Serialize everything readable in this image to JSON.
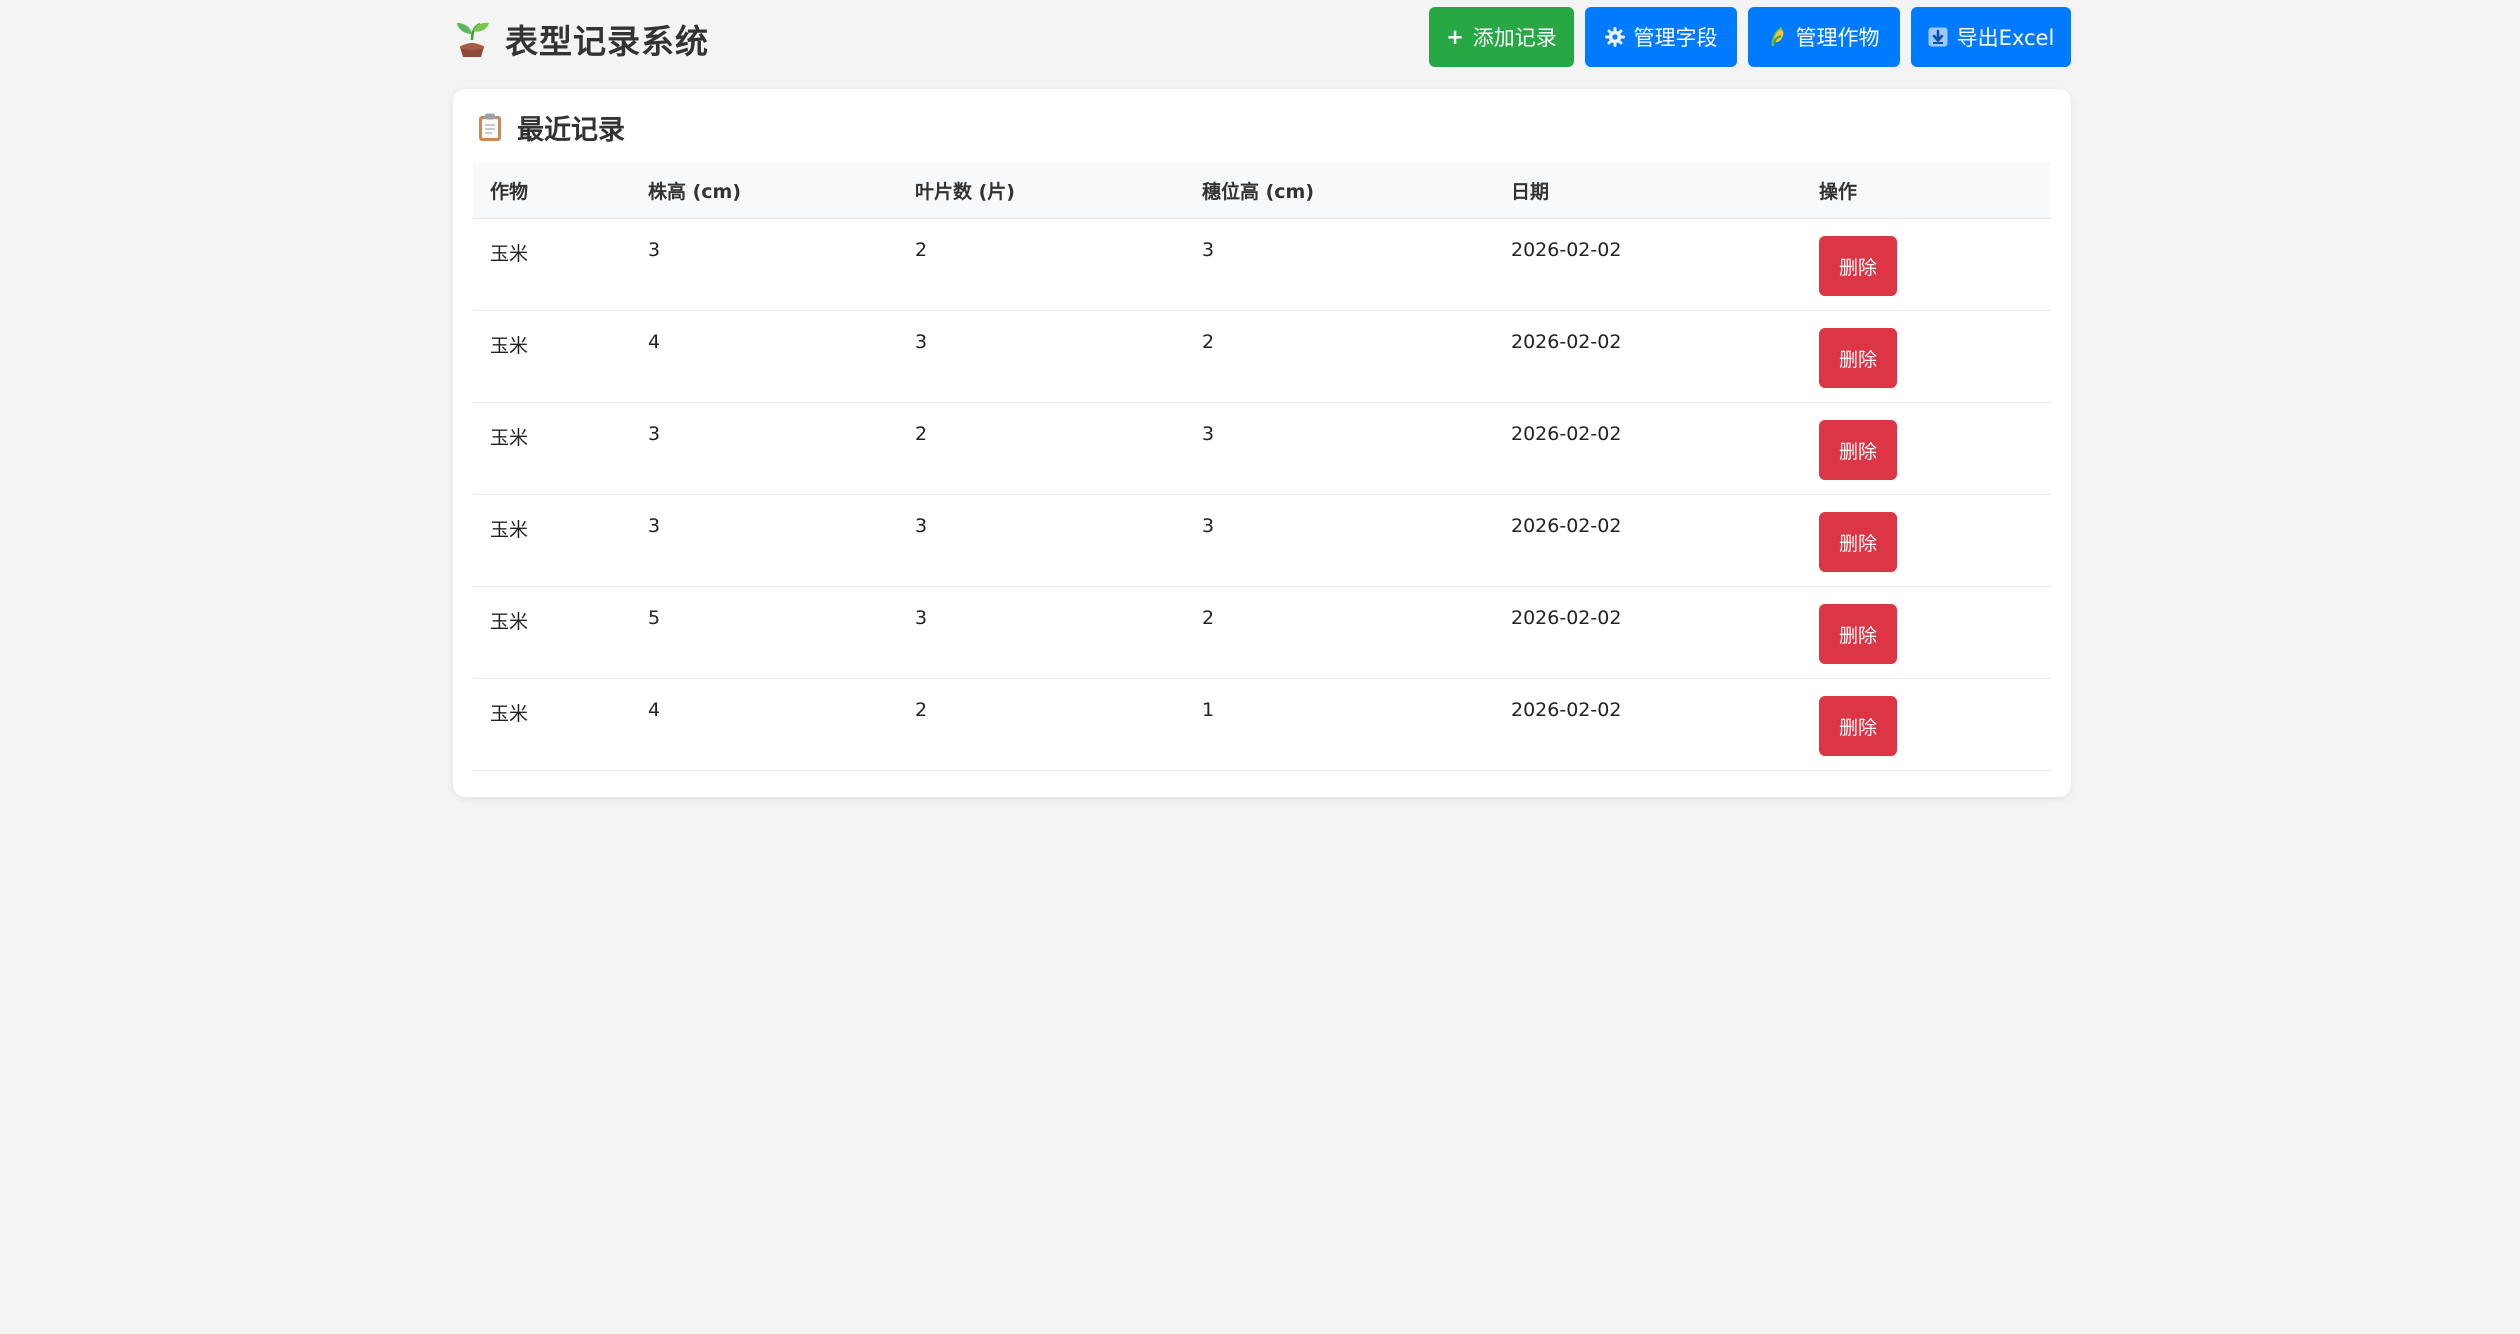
{
  "app": {
    "title": "表型记录系统",
    "logo_icon": "seedling-icon"
  },
  "toolbar": {
    "add_label": "添加记录",
    "add_icon": "plus-icon",
    "fields_label": "管理字段",
    "fields_icon": "gear-icon",
    "crops_label": "管理作物",
    "crops_icon": "corn-icon",
    "export_label": "导出Excel",
    "export_icon": "download-arrow-icon"
  },
  "records": {
    "title": "最近记录",
    "title_icon": "clipboard-icon",
    "columns": [
      "作物",
      "株高 (cm)",
      "叶片数 (片)",
      "穗位高 (cm)",
      "日期",
      "操作"
    ],
    "delete_label": "删除",
    "rows": [
      {
        "crop": "玉米",
        "height": "3",
        "leaves": "2",
        "ear_height": "3",
        "date": "2026-02-02"
      },
      {
        "crop": "玉米",
        "height": "4",
        "leaves": "3",
        "ear_height": "2",
        "date": "2026-02-02"
      },
      {
        "crop": "玉米",
        "height": "3",
        "leaves": "2",
        "ear_height": "3",
        "date": "2026-02-02"
      },
      {
        "crop": "玉米",
        "height": "3",
        "leaves": "3",
        "ear_height": "3",
        "date": "2026-02-02"
      },
      {
        "crop": "玉米",
        "height": "5",
        "leaves": "3",
        "ear_height": "2",
        "date": "2026-02-02"
      },
      {
        "crop": "玉米",
        "height": "4",
        "leaves": "2",
        "ear_height": "1",
        "date": "2026-02-02"
      }
    ]
  },
  "colors": {
    "page_background": "#f4f4f4",
    "add_button": "#28a745",
    "primary_button": "#007bff",
    "delete_button": "#dc3545"
  }
}
